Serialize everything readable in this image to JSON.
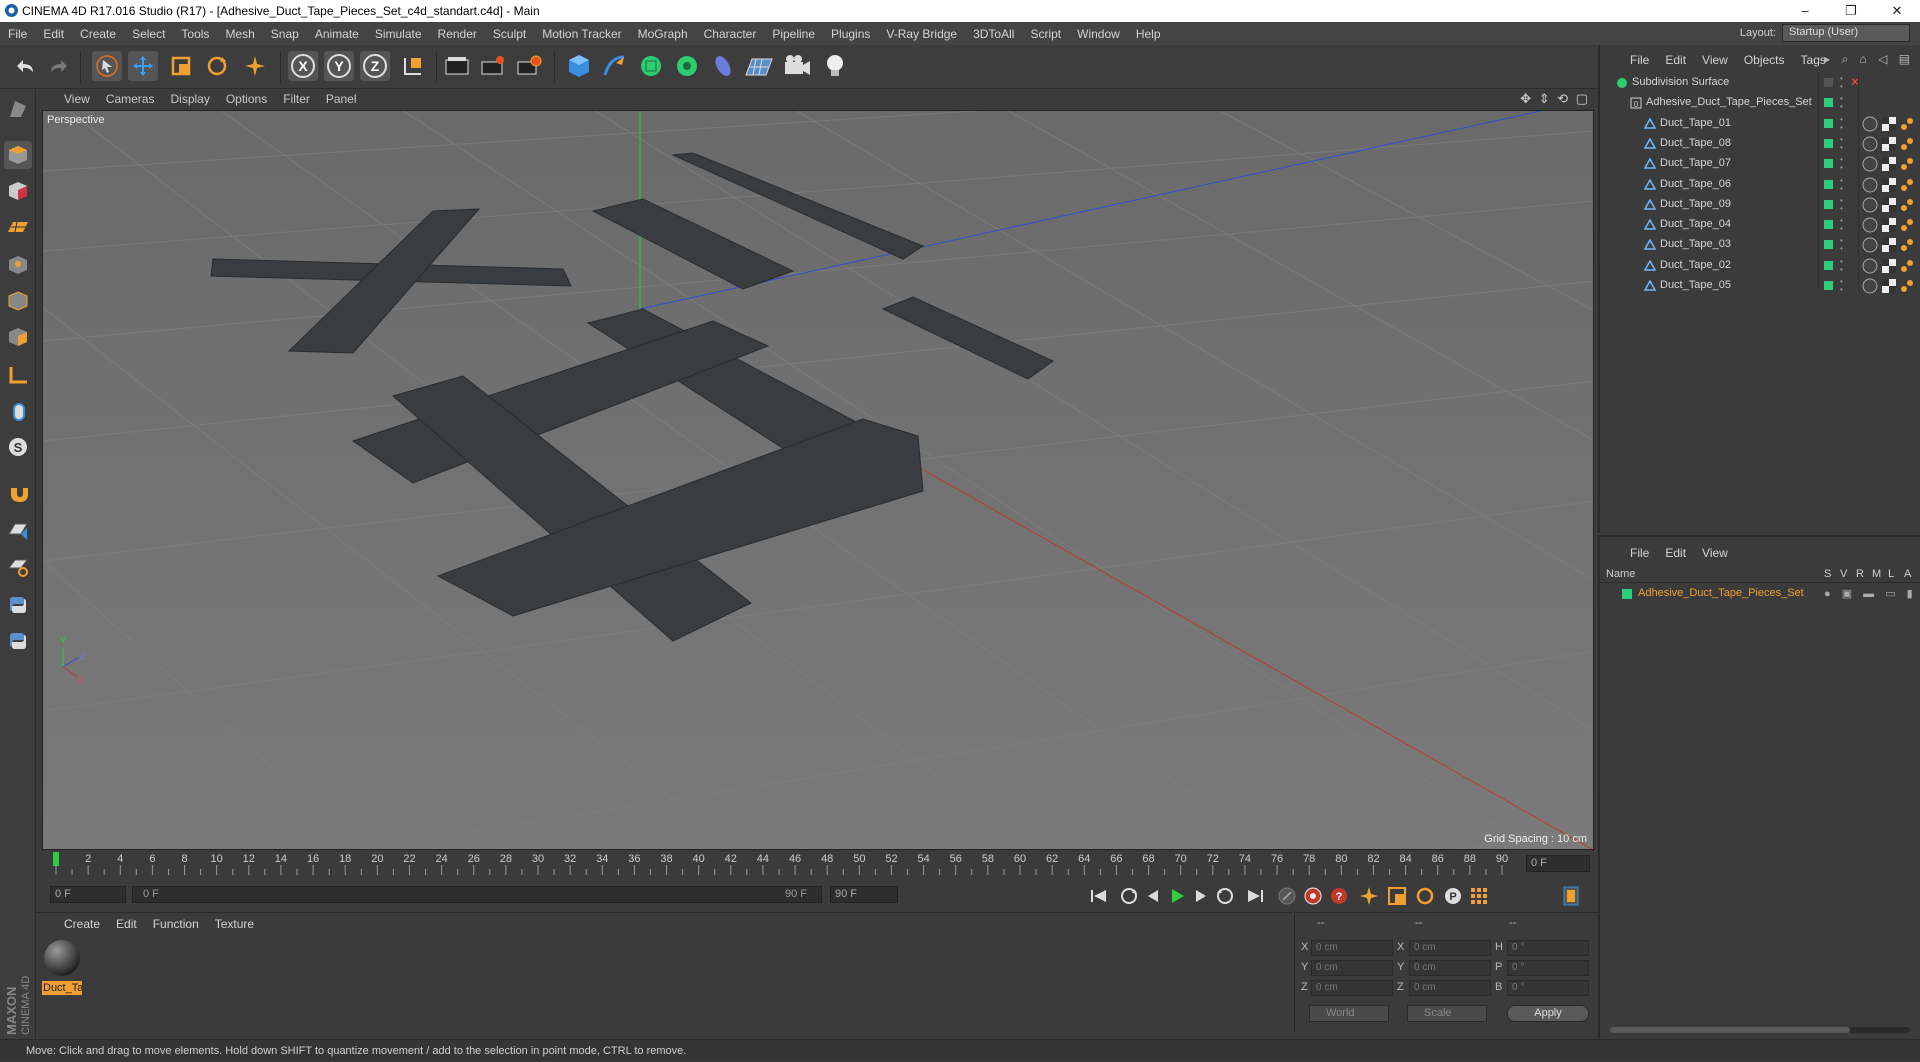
{
  "window": {
    "title": "CINEMA 4D R17.016 Studio (R17) - [Adhesive_Duct_Tape_Pieces_Set_c4d_standart.c4d] - Main",
    "controls": [
      "–",
      "❐",
      "✕"
    ]
  },
  "menubar": {
    "items": [
      "File",
      "Edit",
      "Create",
      "Select",
      "Tools",
      "Mesh",
      "Snap",
      "Animate",
      "Simulate",
      "Render",
      "Sculpt",
      "Motion Tracker",
      "MoGraph",
      "Character",
      "Pipeline",
      "Plugins",
      "V-Ray Bridge",
      "3DToAll",
      "Script",
      "Window",
      "Help"
    ],
    "layout_label": "Layout:",
    "layout_value": "Startup (User)"
  },
  "toolbar": {
    "icons": [
      "undo-icon",
      "redo-icon",
      "select-pointer-icon",
      "move-icon",
      "scale-icon",
      "rotate-icon",
      "live-selection-icon",
      "x-axis-icon",
      "y-axis-icon",
      "z-axis-icon",
      "coordinate-system-icon",
      "render-view-icon",
      "render-picture-viewer-icon",
      "edit-render-settings-icon",
      "cube-icon",
      "pen-spline-icon",
      "subdivision-icon",
      "array-icon",
      "deformer-icon",
      "floor-icon",
      "camera-icon",
      "light-icon"
    ]
  },
  "viewport": {
    "menu": [
      "View",
      "Cameras",
      "Display",
      "Options",
      "Filter",
      "Panel"
    ],
    "label": "Perspective",
    "grid_spacing": "Grid Spacing : 10 cm",
    "axis_labels": [
      "Y",
      "Z",
      "X"
    ]
  },
  "timeline": {
    "ticks": [
      "0",
      "2",
      "4",
      "6",
      "8",
      "10",
      "12",
      "14",
      "16",
      "18",
      "20",
      "22",
      "24",
      "26",
      "28",
      "30",
      "32",
      "34",
      "36",
      "38",
      "40",
      "42",
      "44",
      "46",
      "48",
      "50",
      "52",
      "54",
      "56",
      "58",
      "60",
      "62",
      "64",
      "66",
      "68",
      "70",
      "72",
      "74",
      "76",
      "78",
      "80",
      "82",
      "84",
      "86",
      "88",
      "90"
    ],
    "current_frame": "0 F",
    "start_field": "0 F",
    "range_start": "0 F",
    "range_end": "90 F",
    "end_field": "90 F"
  },
  "material_panel": {
    "menu": [
      "Create",
      "Edit",
      "Function",
      "Texture"
    ],
    "material_name": "Duct_Ta"
  },
  "coordinates": {
    "headers": [
      "--",
      "--",
      "--"
    ],
    "rows": [
      {
        "a_label": "X",
        "a_val": "0 cm",
        "b_label": "X",
        "b_val": "0 cm",
        "c_label": "H",
        "c_val": "0 °"
      },
      {
        "a_label": "Y",
        "a_val": "0 cm",
        "b_label": "Y",
        "b_val": "0 cm",
        "c_label": "P",
        "c_val": "0 °"
      },
      {
        "a_label": "Z",
        "a_val": "0 cm",
        "b_label": "Z",
        "b_val": "0 cm",
        "c_label": "B",
        "c_val": "0 °"
      }
    ],
    "world_select": "World",
    "scale_select": "Scale",
    "apply_label": "Apply"
  },
  "object_manager": {
    "menu": [
      "File",
      "Edit",
      "View",
      "Objects",
      "Tags"
    ],
    "objects": [
      {
        "name": "Subdivision Surface",
        "indent": 0
      },
      {
        "name": "Adhesive_Duct_Tape_Pieces_Set",
        "indent": 1
      },
      {
        "name": "Duct_Tape_01",
        "indent": 2
      },
      {
        "name": "Duct_Tape_08",
        "indent": 2
      },
      {
        "name": "Duct_Tape_07",
        "indent": 2
      },
      {
        "name": "Duct_Tape_06",
        "indent": 2
      },
      {
        "name": "Duct_Tape_09",
        "indent": 2
      },
      {
        "name": "Duct_Tape_04",
        "indent": 2
      },
      {
        "name": "Duct_Tape_03",
        "indent": 2
      },
      {
        "name": "Duct_Tape_02",
        "indent": 2
      },
      {
        "name": "Duct_Tape_05",
        "indent": 2
      }
    ]
  },
  "layers_panel": {
    "menu": [
      "File",
      "Edit",
      "View"
    ],
    "columns": [
      "Name",
      "S",
      "V",
      "R",
      "M",
      "L",
      "A"
    ],
    "item": "Adhesive_Duct_Tape_Pieces_Set"
  },
  "status": {
    "text": "Move: Click and drag to move elements. Hold down SHIFT to quantize movement / add to the selection in point mode, CTRL to remove."
  },
  "brand": {
    "maxon": "MAXON",
    "cinema": "CINEMA 4D"
  },
  "colors": {
    "accent": "#f0a030",
    "green_tag": "#2ecf7a",
    "x_axis": "#c0392b",
    "y_axis": "#2ecc40",
    "z_axis": "#2f4fd0"
  }
}
